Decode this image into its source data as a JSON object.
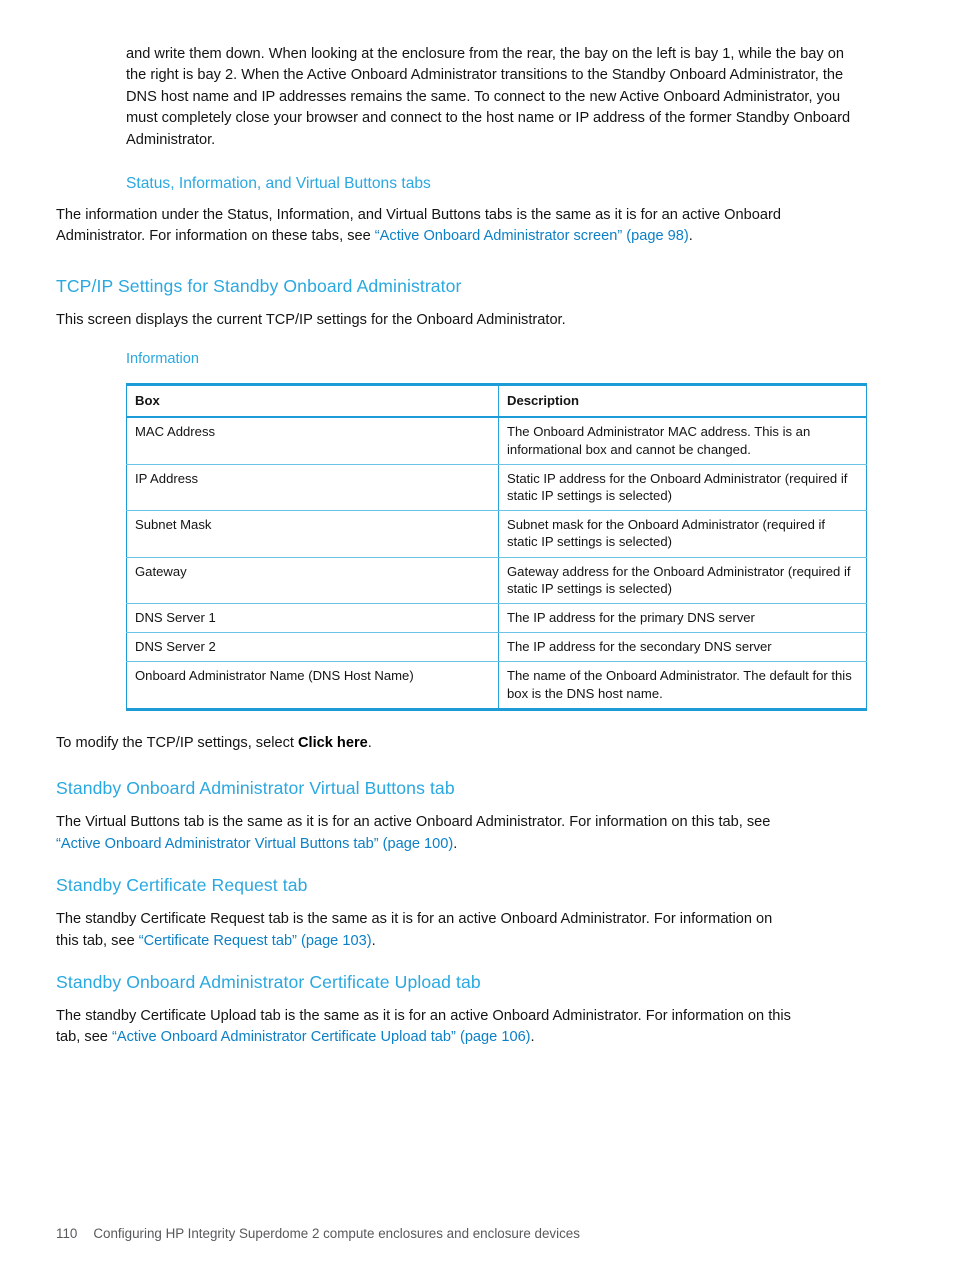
{
  "document": {
    "intro_paragraph": "and write them down. When looking at the enclosure from the rear, the bay on the left is bay 1, while the bay on the right is bay 2. When the Active Onboard Administrator transitions to the Standby Onboard Administrator, the DNS host name and IP addresses remains the same. To connect to the new Active Onboard Administrator, you must completely close your browser and connect to the host name or IP address of the former Standby Onboard Administrator."
  },
  "section_status_tabs": {
    "heading": "Status, Information, and Virtual Buttons tabs",
    "paragraph_part1": "The information under the Status, Information, and Virtual Buttons tabs is the same as it is for an active Onboard Administrator. For information on these tabs, see ",
    "xref": "“Active Onboard Administrator screen” (page 98)",
    "paragraph_part2": "."
  },
  "section_tcpip": {
    "heading": "TCP/IP Settings for Standby Onboard Administrator",
    "paragraph": "This screen displays the current TCP/IP settings for the Onboard Administrator.",
    "table_title": "Information",
    "table": {
      "columns": [
        "Box",
        "Description"
      ],
      "rows": [
        [
          "MAC Address",
          "The Onboard Administrator MAC address. This is an informational box and cannot be changed."
        ],
        [
          "IP Address",
          "Static IP address for the Onboard Administrator (required if static IP settings is selected)"
        ],
        [
          "Subnet Mask",
          "Subnet mask for the Onboard Administrator (required if static IP settings is selected)"
        ],
        [
          "Gateway",
          "Gateway address for the Onboard Administrator (required if static IP settings is selected)"
        ],
        [
          "DNS Server 1",
          "The IP address for the primary DNS server"
        ],
        [
          "DNS Server 2",
          "The IP address for the secondary DNS server"
        ],
        [
          "Onboard Administrator Name (DNS Host Name)",
          "The name of the Onboard Administrator. The default for this box is the DNS host name."
        ]
      ]
    },
    "after_table_part1": "To modify the TCP/IP settings, select ",
    "after_table_bold": "Click here",
    "after_table_part2": "."
  },
  "section_virtual_buttons": {
    "heading": "Standby Onboard Administrator Virtual Buttons tab",
    "paragraph_part1": "The Virtual Buttons tab is the same as it is for an active Onboard Administrator. For information on this tab, see ",
    "xref": "“Active Onboard Administrator Virtual Buttons tab” (page 100)",
    "paragraph_part2": "."
  },
  "section_cert_request": {
    "heading": "Standby Certificate Request tab",
    "paragraph_part1": "The standby Certificate Request tab is the same as it is for an active Onboard Administrator. For information on this tab, see ",
    "xref": "“Certificate Request tab” (page 103)",
    "paragraph_part2": "."
  },
  "section_cert_upload": {
    "heading": "Standby Onboard Administrator Certificate Upload tab",
    "paragraph_part1": "The standby Certificate Upload tab is the same as it is for an active Onboard Administrator. For information on this tab, see ",
    "xref": "“Active Onboard Administrator Certificate Upload tab” (page 106)",
    "paragraph_part2": "."
  },
  "footer": {
    "page_number": "110",
    "chapter_title": "Configuring HP Integrity Superdome 2 compute enclosures and enclosure devices"
  },
  "colors": {
    "heading_blue": "#2aa8e0",
    "xref_blue": "#0c80c6",
    "table_border_blue": "#1d9bd7",
    "footer_gray": "#58595b"
  }
}
